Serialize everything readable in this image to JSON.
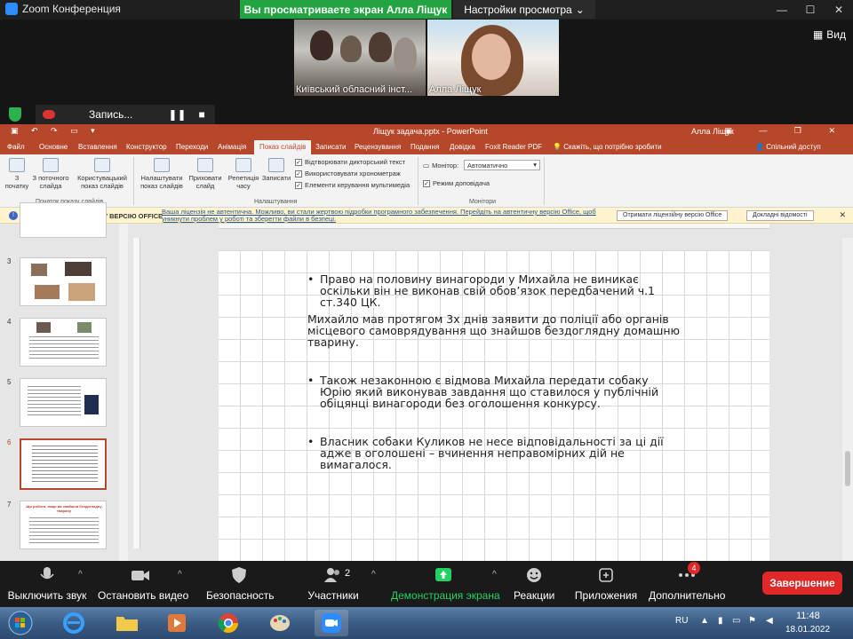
{
  "zoom": {
    "app_title": "Zoom Конференция",
    "share_banner": "Вы просматриваете экран Алла Ліщук",
    "view_options": "Настройки просмотра",
    "view_button": "Вид",
    "recording_label": "Запись...",
    "participants": [
      {
        "name": "Київський обласний інст..."
      },
      {
        "name": "Алла Ліщук"
      }
    ]
  },
  "ppt": {
    "doc_title": "Ліщук задача.pptx - PowerPoint",
    "user": "Алла Ліщук",
    "tabs": [
      "Файл",
      "Основне",
      "Вставлення",
      "Конструктор",
      "Переходи",
      "Анімація",
      "Показ слайдів",
      "Записати",
      "Рецензування",
      "Подання",
      "Довідка",
      "Foxit Reader PDF"
    ],
    "active_tab": "Показ слайдів",
    "tell_me": "Скажіть, що потрібно зробити",
    "share": "Спільний доступ",
    "ribbon": {
      "from_start": "З початку",
      "from_current": "З поточного слайда",
      "custom_show": "Користувацький показ слайдів",
      "group_start": "Початок показу слайдів",
      "setup_show": "Налаштувати показ слайдів",
      "hide_slide": "Приховати слайд",
      "rehearse": "Репетиція часу",
      "record": "Записати",
      "play_narrations": "Відтворювати дикторський текст",
      "use_timings": "Використовувати хронометраж",
      "media_controls": "Елементи керування мультимедіа",
      "group_setup": "Налаштування",
      "monitor_label": "Монітор:",
      "monitor_value": "Автоматично",
      "presenter_view": "Режим доповідача",
      "group_monitors": "Монітори"
    },
    "license": {
      "title": "ОТРИМАЙТЕ ЛІЦЕНЗІЙНУ ВЕРСІЮ OFFICE",
      "message": "Ваша ліцензія не автентична. Можливо, ви стали жертвою підробки програмного забезпечення. Перейдіть на автентичну версію Office, щоб уникнути проблем у роботі та зберегти файли в безпеці.",
      "get_button": "Отримати ліцензійну версію Office",
      "details_button": "Докладні відомості"
    },
    "thumbnails": [
      {
        "num": "3"
      },
      {
        "num": "4"
      },
      {
        "num": "5"
      },
      {
        "num": "6"
      },
      {
        "num": "7"
      }
    ],
    "thumb7_title": "Що робити, якщо ви знайшли бездоглядну тварину",
    "slide": {
      "b1": "Право на половину винагороди у Михайла не виникає оскільки він не виконав свій обов’язок передбачений ч.1 ст.340 ЦК.",
      "p1": "Михайло мав протягом 3х днів заявити до поліції або органів місцевого самоврядування що знайшов бездоглядну домашню тварину.",
      "b2": "Також незаконною є відмова Михайла передати собаку Юрію який виконував завдання що ставилося у публічній обіцянці винагороди без оголошення конкурсу.",
      "b3": "Власник собаки Куликов не несе відповідальності за ці дії адже в оголошені – вчинення неправомірних дій не вимагалося."
    }
  },
  "toolbar": {
    "mute": "Выключить звук",
    "stop_video": "Остановить видео",
    "security": "Безопасность",
    "participants": "Участники",
    "participants_count": "2",
    "share_screen": "Демонстрация экрана",
    "reactions": "Реакции",
    "apps": "Приложения",
    "more": "Дополнительно",
    "more_badge": "4",
    "end": "Завершение"
  },
  "taskbar": {
    "lang": "RU",
    "time": "11:48",
    "date": "18.01.2022"
  }
}
